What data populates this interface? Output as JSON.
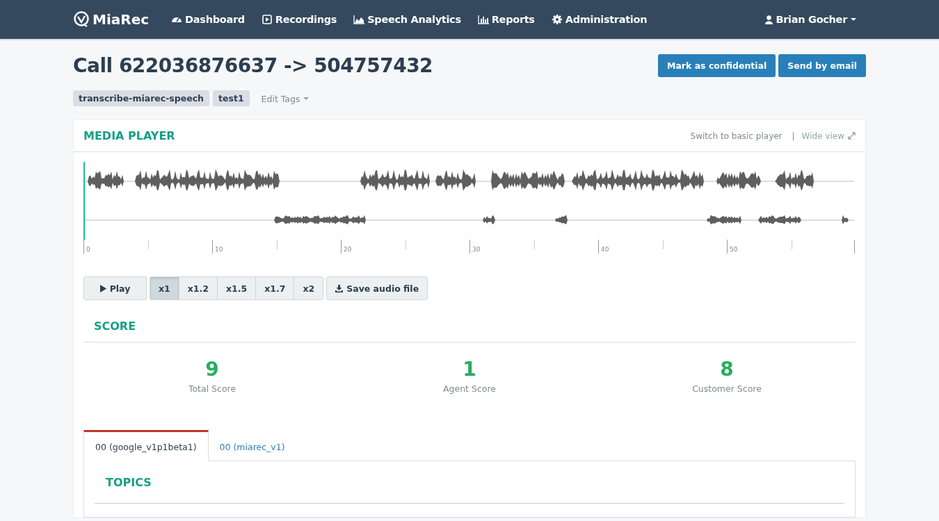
{
  "navbar": {
    "brand": "MiaRec",
    "items": [
      {
        "label": "Dashboard",
        "kind": "gauge"
      },
      {
        "label": "Recordings",
        "kind": "play"
      },
      {
        "label": "Speech Analytics",
        "kind": "area"
      },
      {
        "label": "Reports",
        "kind": "bars"
      },
      {
        "label": "Administration",
        "kind": "gear"
      }
    ],
    "user": "Brian Gocher"
  },
  "page": {
    "title": "Call 622036876637 -> 504757432",
    "actions": [
      "Mark as confidential",
      "Send by email"
    ],
    "tags": [
      "transcribe-miarec-speech",
      "test1"
    ],
    "edit_tags": "Edit Tags"
  },
  "media_player": {
    "title": "MEDIA  PLAYER",
    "switch_link": "Switch  to  basic  player",
    "separator": "|",
    "wide_view": "Wide  view",
    "timeline_labels": [
      "0",
      "10",
      "20",
      "30",
      "40",
      "50"
    ],
    "play": "Play",
    "speeds": [
      {
        "label": "x1",
        "selected": true
      },
      {
        "label": "x1.2",
        "selected": false
      },
      {
        "label": "x1.5",
        "selected": false
      },
      {
        "label": "x1.7",
        "selected": false
      },
      {
        "label": "x2",
        "selected": false
      }
    ],
    "save": "Save audio file"
  },
  "score": {
    "title": "SCORE",
    "items": [
      {
        "value": "9",
        "label": "Total Score"
      },
      {
        "value": "1",
        "label": "Agent Score"
      },
      {
        "value": "8",
        "label": "Customer Score"
      }
    ]
  },
  "tabs": [
    {
      "label": "00 (google_v1p1beta1)",
      "selected": true
    },
    {
      "label": "00 (miarec_v1)",
      "selected": false
    }
  ],
  "topics": {
    "title": "TOPICS"
  }
}
